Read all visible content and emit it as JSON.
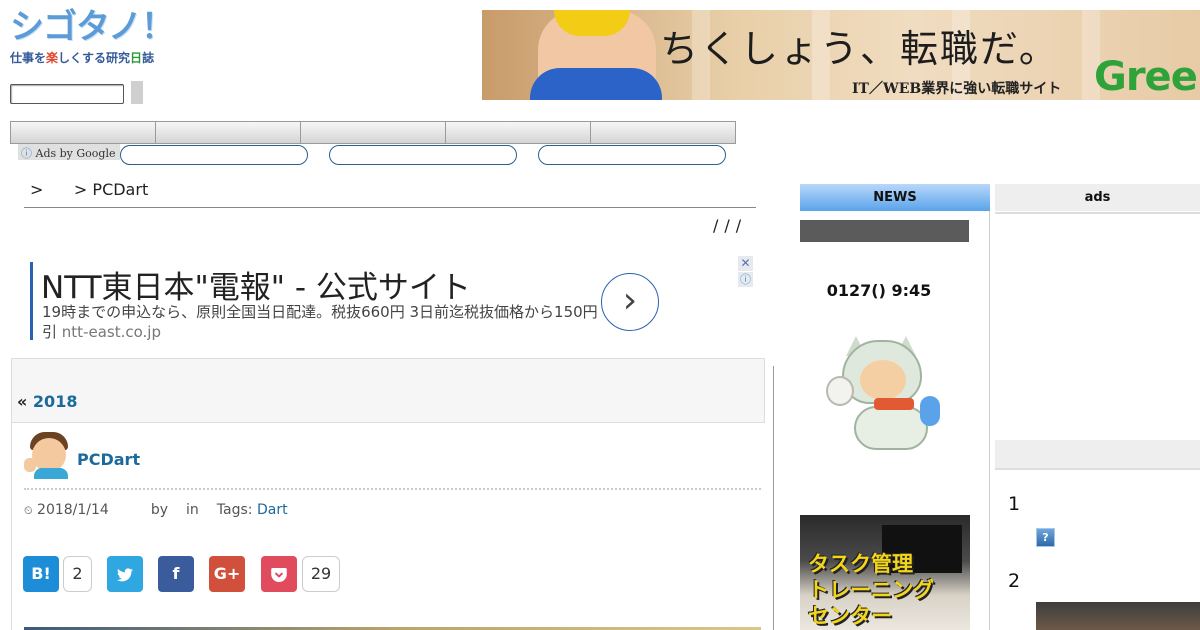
{
  "site": {
    "logo_main": "シゴタノ！",
    "logo_sub_1": "仕事を",
    "logo_sub_2": "楽",
    "logo_sub_3": "しくする研究",
    "logo_sub_4": "日",
    "logo_sub_5": "誌"
  },
  "banner": {
    "headline": "ちくしょう、転職だ。",
    "tagline": "IT／WEB業界に強い転職サイト",
    "brand": "Green"
  },
  "ads_by_google": {
    "info_glyph": "ⓘ",
    "label": "Ads by Google"
  },
  "breadcrumb": ">      > PCDart",
  "slashes": "///",
  "text_ad": {
    "title": "NTT東日本\"電報\" - 公式サイト",
    "description": "19時までの申込なら、原則全国当日配達。税抜660円 3日前迄税抜価格から150円引",
    "domain": "ntt-east.co.jp",
    "arrow": "›",
    "close": "✕",
    "info": "ⓘ"
  },
  "prev_post": {
    "quote": "«",
    "label": "2018"
  },
  "post": {
    "title": "PCDart",
    "date_icon": "⏲",
    "date": "2018/1/14",
    "by": "by",
    "in": "in",
    "tags_label": "Tags:",
    "tag": "Dart"
  },
  "share": {
    "hatena_label": "B!",
    "hatena_count": "2",
    "twitter_glyph": "🐦",
    "facebook_label": "f",
    "gplus_label": "G+",
    "pocket_glyph": "♥",
    "pocket_count": "29"
  },
  "sidebar": {
    "news_header": "NEWS",
    "news_date": "0127() 9:45",
    "task_image_text": "タスク管理\nトレーニング\nセンター",
    "ads_header": "ads",
    "rank_1": "1",
    "rank_icon": "?",
    "rank_2": "2"
  },
  "colors": {
    "link": "#1a6a9a",
    "news_header": "#5aa3ea",
    "hatena": "#1d8dd8",
    "twitter": "#2fa7e0",
    "facebook": "#3b5c9c",
    "gplus": "#d0503c",
    "pocket": "#e04b5e"
  }
}
